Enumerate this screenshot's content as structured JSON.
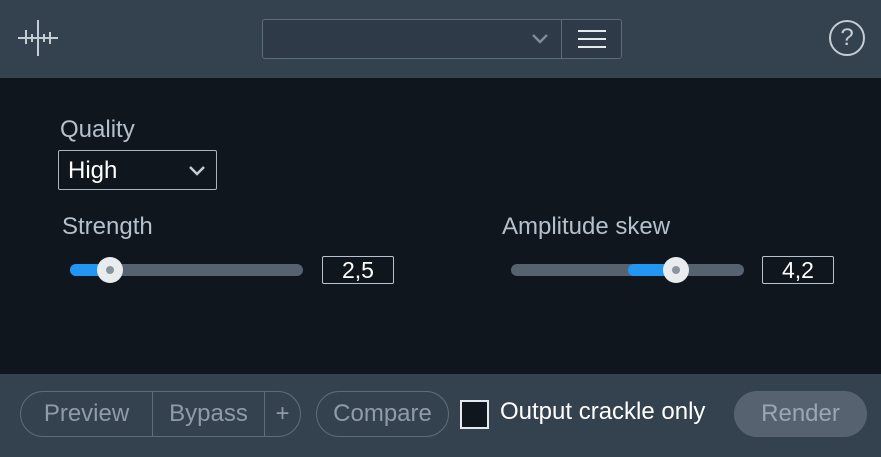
{
  "header": {
    "preset_value": "",
    "help_label": "?"
  },
  "quality": {
    "label": "Quality",
    "value": "High"
  },
  "strength": {
    "label": "Strength",
    "value": "2,5",
    "level_fraction": 0.17
  },
  "amplitude_skew": {
    "label": "Amplitude skew",
    "value": "4,2",
    "level_fraction": 0.71,
    "fill_start_fraction": 0.5
  },
  "footer": {
    "preview_label": "Preview",
    "bypass_label": "Bypass",
    "add_label": "+",
    "compare_label": "Compare",
    "output_crackle_label": "Output crackle only",
    "render_label": "Render"
  },
  "colors": {
    "accent": "#2196f3",
    "header_bg": "#34414f",
    "panel_bg": "#0f161d"
  },
  "icons": {
    "logo": "waveform-logo-icon",
    "preset_dropdown": "chevron-down-icon",
    "menu": "hamburger-menu-icon",
    "help": "question-mark-icon"
  }
}
